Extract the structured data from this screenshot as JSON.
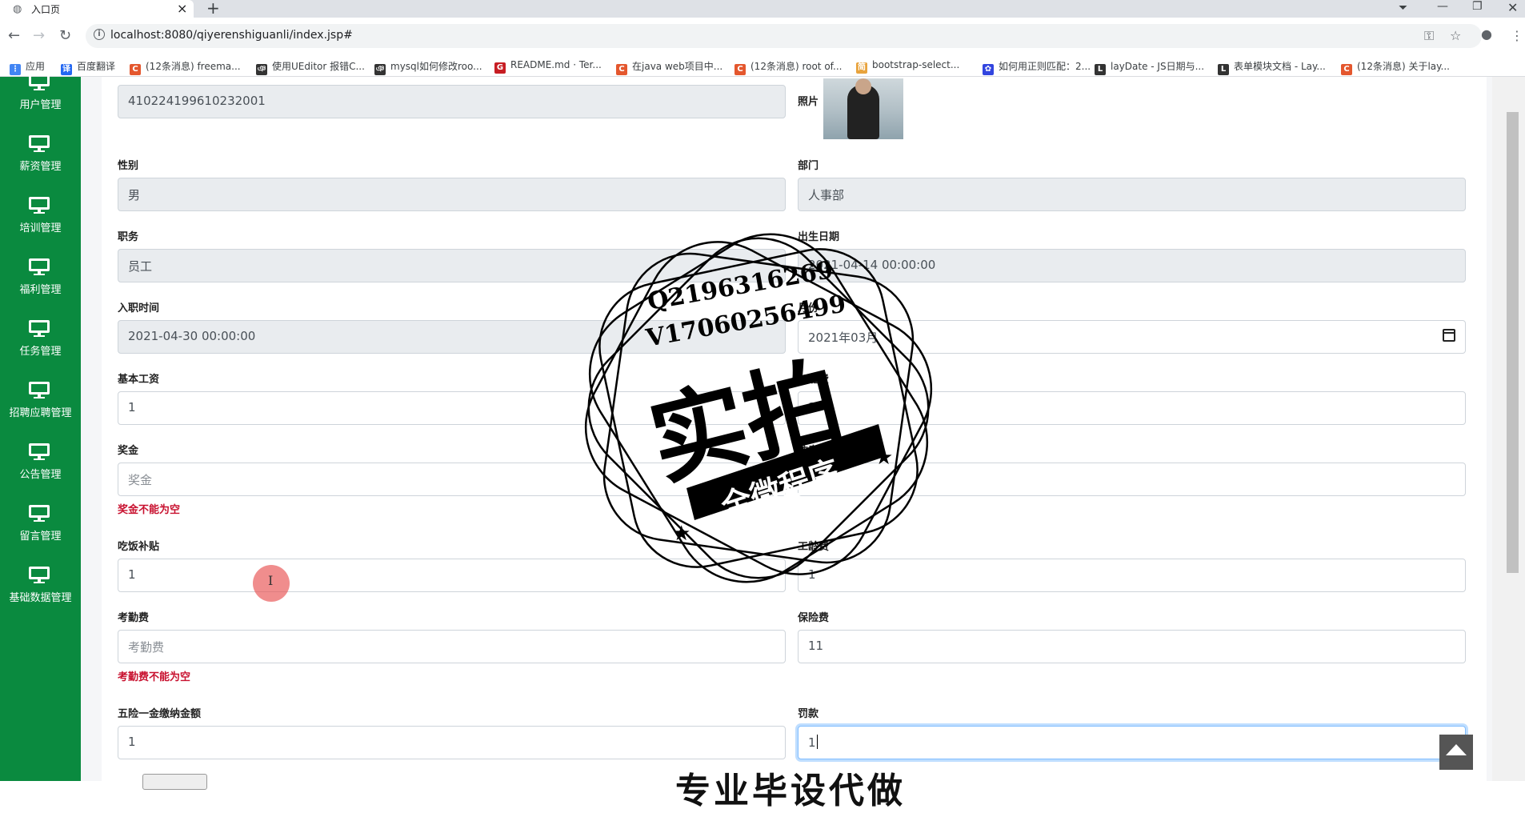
{
  "browser": {
    "tab_title": "入口页",
    "url": "localhost:8080/qiyerenshiguanli/index.jsp#",
    "bookmarks": [
      {
        "label": "应用",
        "color": "#4285f4",
        "glyph": "⋮"
      },
      {
        "label": "百度翻译",
        "color": "#2468f2",
        "glyph": "译"
      },
      {
        "label": "(12条消息) freema...",
        "color": "#e4572e",
        "glyph": "C"
      },
      {
        "label": "使用UEditor 报错C...",
        "color": "#333333",
        "glyph": "ঞ"
      },
      {
        "label": "mysql如何修改roo...",
        "color": "#333333",
        "glyph": "ঞ"
      },
      {
        "label": "README.md · Ter...",
        "color": "#c71d23",
        "glyph": "G"
      },
      {
        "label": "在java web项目中...",
        "color": "#e4572e",
        "glyph": "C"
      },
      {
        "label": "(12条消息) root of...",
        "color": "#e4572e",
        "glyph": "C"
      },
      {
        "label": "bootstrap-select...",
        "color": "#e8a33d",
        "glyph": "简"
      },
      {
        "label": "如何用正则匹配：2...",
        "color": "#3245df",
        "glyph": "✿"
      },
      {
        "label": "layDate - JS日期与...",
        "color": "#333333",
        "glyph": "L"
      },
      {
        "label": "表单模块文档 - Lay...",
        "color": "#333333",
        "glyph": "L"
      },
      {
        "label": "(12条消息) 关于lay...",
        "color": "#e4572e",
        "glyph": "C"
      }
    ]
  },
  "sidebar": {
    "items": [
      {
        "label": "用户管理"
      },
      {
        "label": "薪资管理"
      },
      {
        "label": "培训管理"
      },
      {
        "label": "福利管理"
      },
      {
        "label": "任务管理"
      },
      {
        "label": "招聘应聘管理"
      },
      {
        "label": "公告管理"
      },
      {
        "label": "留言管理"
      },
      {
        "label": "基础数据管理"
      }
    ]
  },
  "form": {
    "id_card_value": "410224199610232001",
    "photo_label": "照片",
    "gender_label": "性别",
    "gender_value": "男",
    "department_label": "部门",
    "department_value": "人事部",
    "position_label": "职务",
    "position_value": "员工",
    "birth_label": "出生日期",
    "birth_value": "2021-04-14 00:00:00",
    "hire_label": "入职时间",
    "hire_value": "2021-04-30 00:00:00",
    "month_label": "月份",
    "month_value": "2021年03月",
    "base_salary_label": "基本工资",
    "base_salary_value": "1",
    "overtime_label": "加班费",
    "overtime_value": "1",
    "bonus_label": "奖金",
    "bonus_placeholder": "奖金",
    "bonus_error": "奖金不能为空",
    "housing_label": "住房补贴",
    "housing_value": "",
    "meal_label": "吃饭补贴",
    "meal_value": "1",
    "seniority_label": "工龄费",
    "seniority_value": "1",
    "attendance_label": "考勤费",
    "attendance_placeholder": "考勤费",
    "attendance_error": "考勤费不能为空",
    "insurance_label": "保险费",
    "insurance_value": "11",
    "fund_label": "五险一金缴纳金额",
    "fund_value": "1",
    "fine_label": "罚款",
    "fine_value": "1"
  },
  "watermark": {
    "qq": "Q2196316269",
    "vx": "V17060256499",
    "big": "实拍",
    "banner": "全微程序",
    "bottom": "专业毕设代做"
  }
}
